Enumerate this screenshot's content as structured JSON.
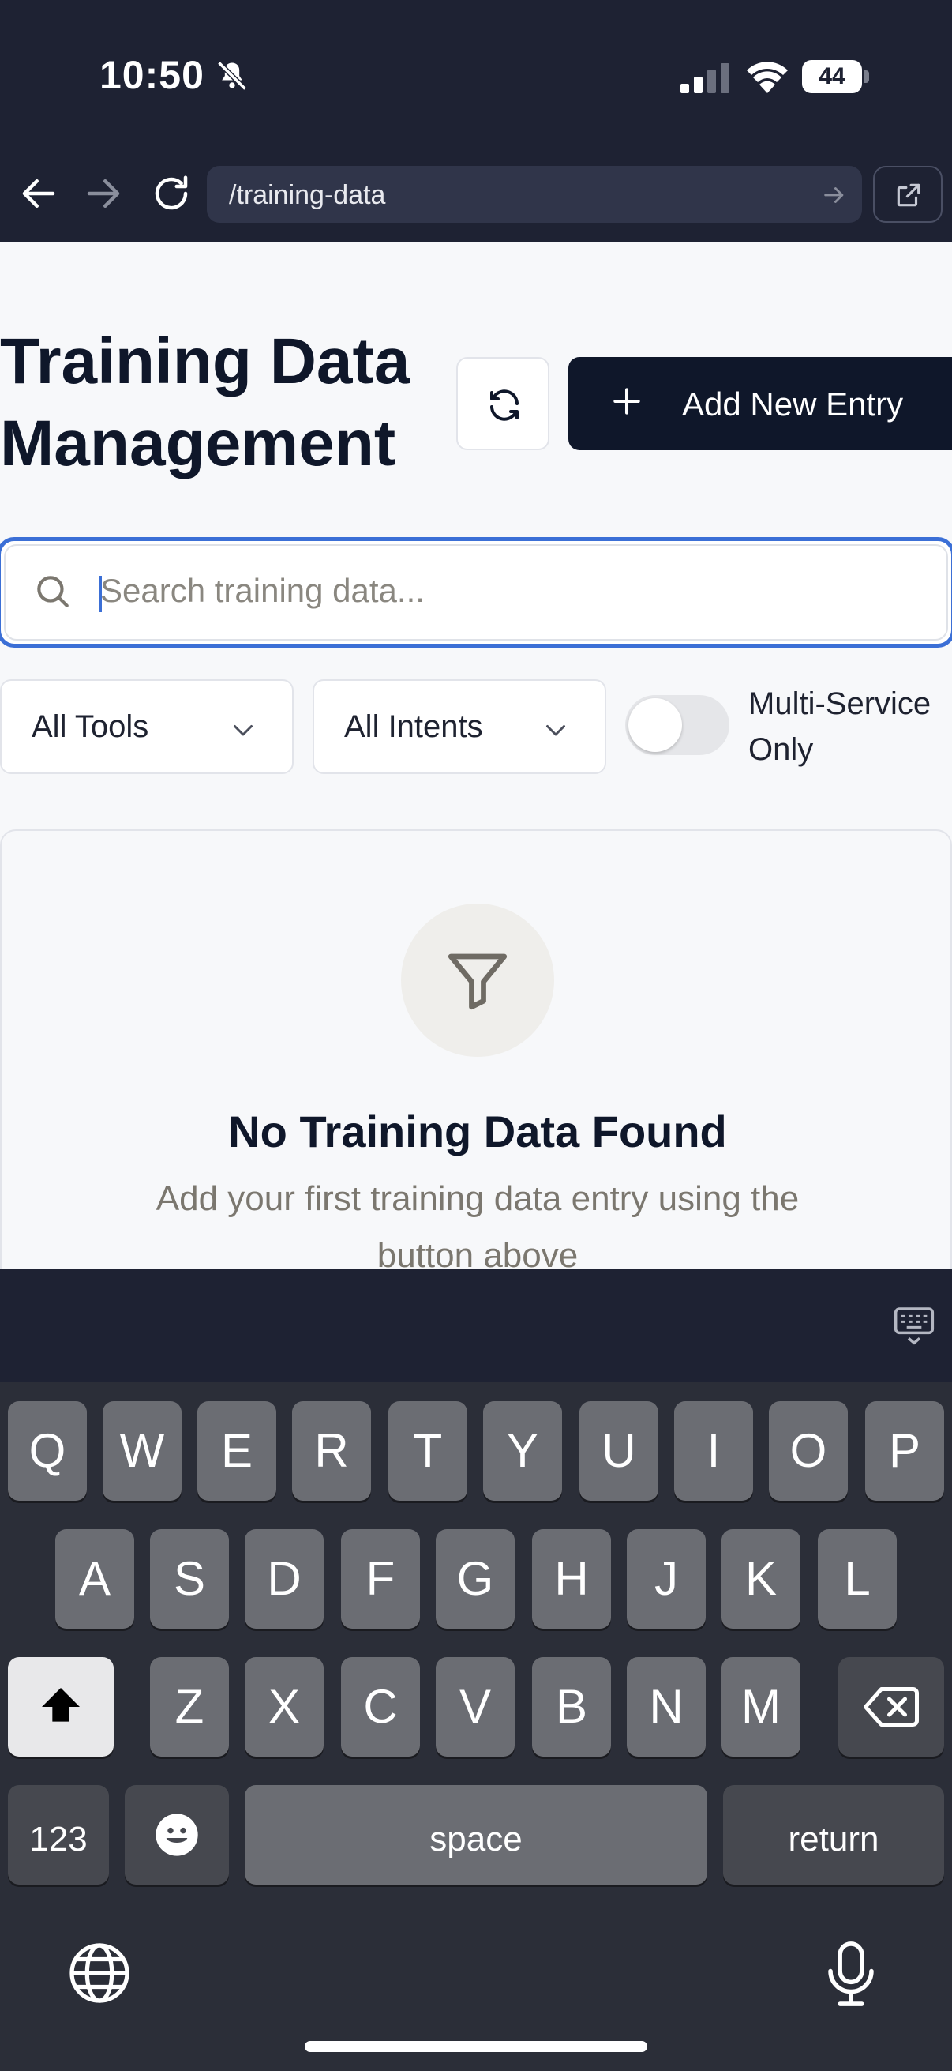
{
  "status": {
    "time": "10:50",
    "battery": "44"
  },
  "browser": {
    "url": "/training-data"
  },
  "page": {
    "title": "Training Data Management",
    "add_button": "Add New Entry",
    "search_placeholder": "Search training data...",
    "tools_select": "All Tools",
    "intents_select": "All Intents",
    "toggle_label": "Multi-Service Only",
    "toggle_on": false,
    "empty_title": "No Training Data Found",
    "empty_desc": "Add your first training data entry using the button above"
  },
  "keyboard": {
    "row1": [
      "Q",
      "W",
      "E",
      "R",
      "T",
      "Y",
      "U",
      "I",
      "O",
      "P"
    ],
    "row2": [
      "A",
      "S",
      "D",
      "F",
      "G",
      "H",
      "J",
      "K",
      "L"
    ],
    "row3": [
      "Z",
      "X",
      "C",
      "V",
      "B",
      "N",
      "M"
    ],
    "numbers": "123",
    "space": "space",
    "return": "return"
  },
  "colors": {
    "accent": "#3b6fd6",
    "primary": "#0f172a",
    "chrome": "#1e2233"
  }
}
